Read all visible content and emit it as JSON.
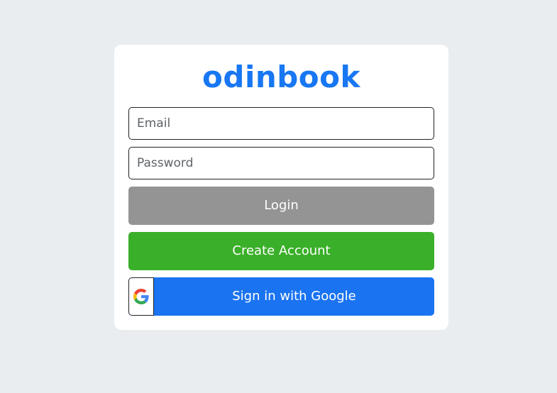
{
  "brand": {
    "logo_text": "odinbook"
  },
  "form": {
    "email_placeholder": "Email",
    "password_placeholder": "Password",
    "email_value": "",
    "password_value": ""
  },
  "buttons": {
    "login_label": "Login",
    "create_account_label": "Create Account",
    "google_label": "Sign in with Google"
  },
  "icons": {
    "google": "google-logo-icon"
  },
  "colors": {
    "page_background": "#e9edf0",
    "brand_blue": "#1877f2",
    "login_gray": "#949494",
    "create_green": "#3aaf29",
    "google_blue": "#1a73f0"
  }
}
